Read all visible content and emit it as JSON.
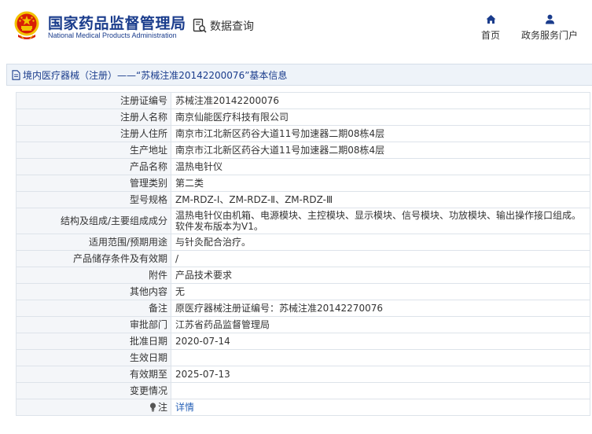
{
  "header": {
    "brand_cn": "国家药品监督管理局",
    "brand_en": "National Medical Products Administration",
    "query_label": "数据查询",
    "nav": [
      {
        "label": "首页",
        "icon": "home-icon"
      },
      {
        "label": "政务服务门户",
        "icon": "user-icon"
      }
    ]
  },
  "titlebar": {
    "text": "境内医疗器械（注册）——“苏械注准20142200076”基本信息"
  },
  "rows": [
    {
      "label": "注册证编号",
      "value": "苏械注准20142200076"
    },
    {
      "label": "注册人名称",
      "value": "南京仙能医疗科技有限公司"
    },
    {
      "label": "注册人住所",
      "value": "南京市江北新区药谷大道11号加速器二期08栋4层"
    },
    {
      "label": "生产地址",
      "value": "南京市江北新区药谷大道11号加速器二期08栋4层"
    },
    {
      "label": "产品名称",
      "value": "温热电针仪"
    },
    {
      "label": "管理类别",
      "value": "第二类"
    },
    {
      "label": "型号规格",
      "value": "ZM-RDZ-Ⅰ、ZM-RDZ-Ⅱ、ZM-RDZ-Ⅲ"
    },
    {
      "label": "结构及组成/主要组成成分",
      "value": "温热电针仪由机箱、电源模块、主控模块、显示模块、信号模块、功放模块、输出操作接口组成。软件发布版本为V1。"
    },
    {
      "label": "适用范围/预期用途",
      "value": "与针灸配合治疗。"
    },
    {
      "label": "产品储存条件及有效期",
      "value": "/"
    },
    {
      "label": "附件",
      "value": "产品技术要求"
    },
    {
      "label": "其他内容",
      "value": "无"
    },
    {
      "label": "备注",
      "value": "原医疗器械注册证编号：苏械注准20142270076"
    },
    {
      "label": "审批部门",
      "value": "江苏省药品监督管理局"
    },
    {
      "label": "批准日期",
      "value": "2020-07-14"
    },
    {
      "label": "生效日期",
      "value": ""
    },
    {
      "label": "有效期至",
      "value": "2025-07-13"
    },
    {
      "label": "变更情况",
      "value": ""
    },
    {
      "label": "注",
      "value": "详情"
    }
  ],
  "colors": {
    "brand_blue": "#1a3c8c",
    "emblem_red": "#d81e06",
    "emblem_gold": "#f2c200",
    "link_blue": "#2a63b8",
    "label_bg": "#f4f6f9",
    "titlebar_bg": "#eef3f9"
  }
}
